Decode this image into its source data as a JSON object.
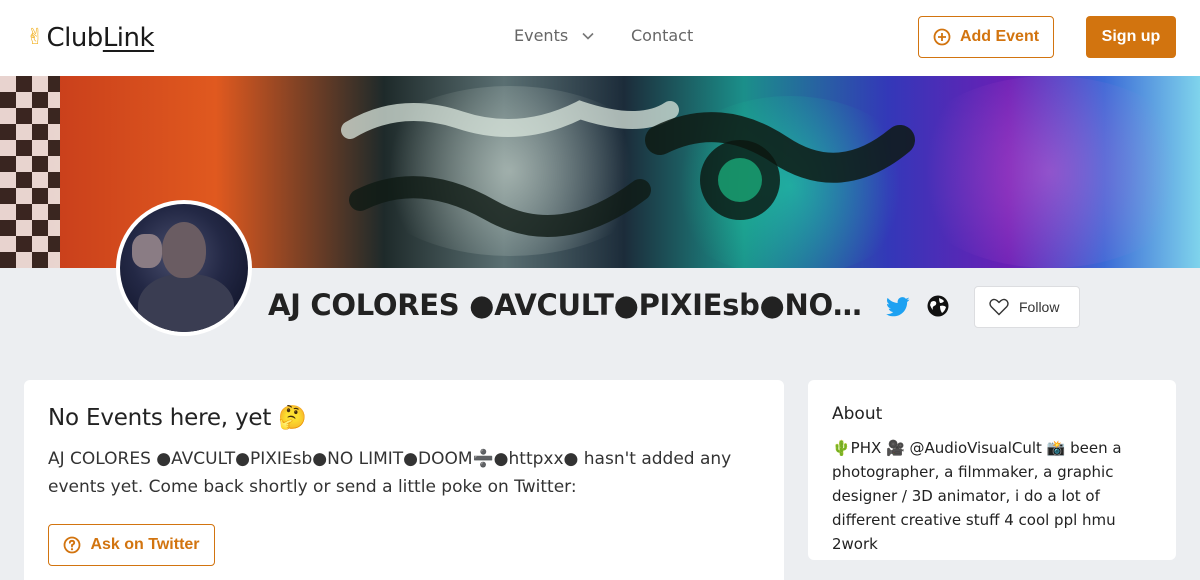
{
  "header": {
    "logo_text_a": "Club",
    "logo_text_b": "Link",
    "logo_icon": "victory-hand-icon",
    "nav": {
      "events_label": "Events",
      "contact_label": "Contact"
    },
    "add_event_label": "Add Event",
    "signup_label": "Sign up"
  },
  "profile": {
    "name": "AJ COLORES ●AVCULT●PIXIEsb●NO LIMIT●DOOM➗●httpxx●",
    "follow_label": "Follow",
    "links": [
      "twitter-icon",
      "globe-icon"
    ]
  },
  "events_card": {
    "title": "No Events here, yet 🤔",
    "message": "AJ COLORES ●AVCULT●PIXIEsb●NO LIMIT●DOOM➗●httpxx● hasn't added any events yet. Come back shortly or send a little poke on Twitter:",
    "ask_button_label": "Ask on Twitter"
  },
  "about_card": {
    "title": "About",
    "bio": "🌵PHX 🎥 @AudioVisualCult 📸 been a photographer, a filmmaker, a graphic designer / 3D animator, i do a lot of different creative stuff 4 cool ppl hmu 2work"
  },
  "colors": {
    "accent": "#d2740f",
    "page_bg": "#eceef1",
    "twitter": "#1da1f2"
  }
}
